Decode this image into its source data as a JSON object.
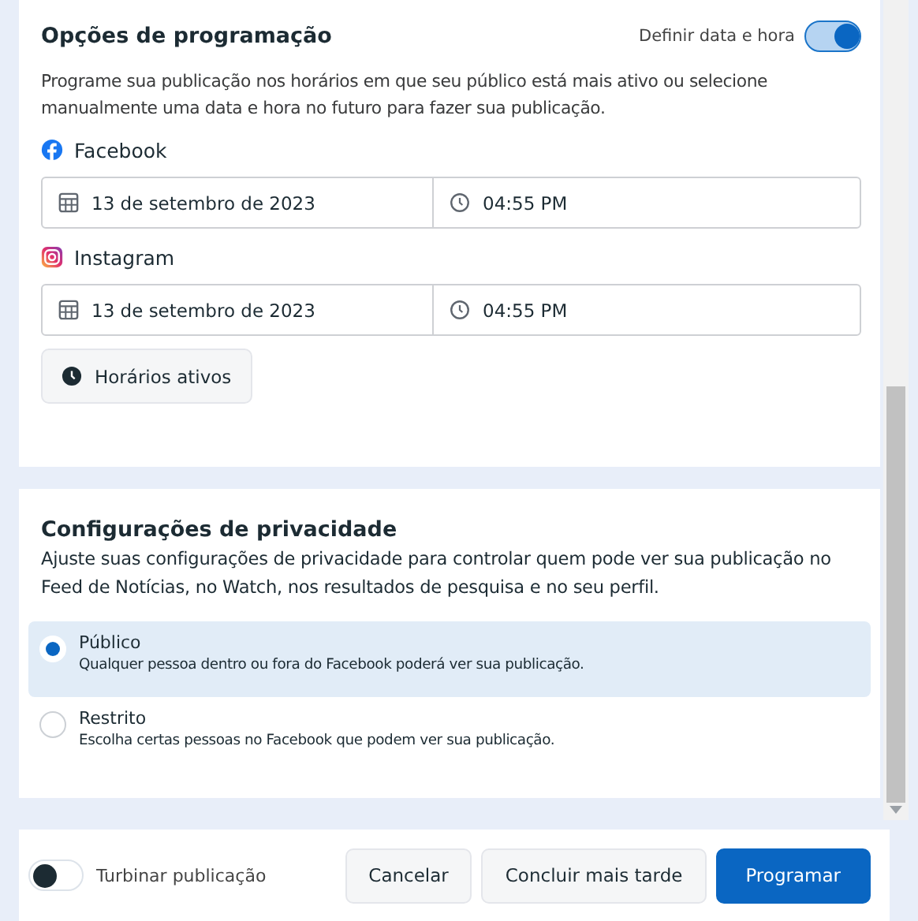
{
  "scheduling": {
    "title": "Opções de programação",
    "toggle": {
      "label": "Definir data e hora",
      "on": true
    },
    "description": "Programe sua publicação nos horários em que seu público está mais ativo ou selecione manualmente uma data e hora no futuro para fazer sua publicação.",
    "platforms": [
      {
        "kind": "facebook",
        "name": "Facebook",
        "date": "13 de setembro de 2023",
        "time": "04:55 PM"
      },
      {
        "kind": "instagram",
        "name": "Instagram",
        "date": "13 de setembro de 2023",
        "time": "04:55 PM"
      }
    ],
    "active_times_button": "Horários ativos"
  },
  "privacy": {
    "title": "Configurações de privacidade",
    "description": "Ajuste suas configurações de privacidade para controlar quem pode ver sua publicação no Feed de Notícias, no Watch, nos resultados de pesquisa e no seu perfil.",
    "options": [
      {
        "label": "Público",
        "detail": "Qualquer pessoa dentro ou fora do Facebook poderá ver sua publicação.",
        "selected": true
      },
      {
        "label": "Restrito",
        "detail": "Escolha certas pessoas no Facebook que podem ver sua publicação.",
        "selected": false
      }
    ]
  },
  "footer": {
    "boost": {
      "label": "Turbinar publicação",
      "on": false
    },
    "buttons": [
      {
        "label": "Cancelar",
        "kind": "secondary"
      },
      {
        "label": "Concluir mais tarde",
        "kind": "secondary"
      },
      {
        "label": "Programar",
        "kind": "primary"
      }
    ]
  }
}
